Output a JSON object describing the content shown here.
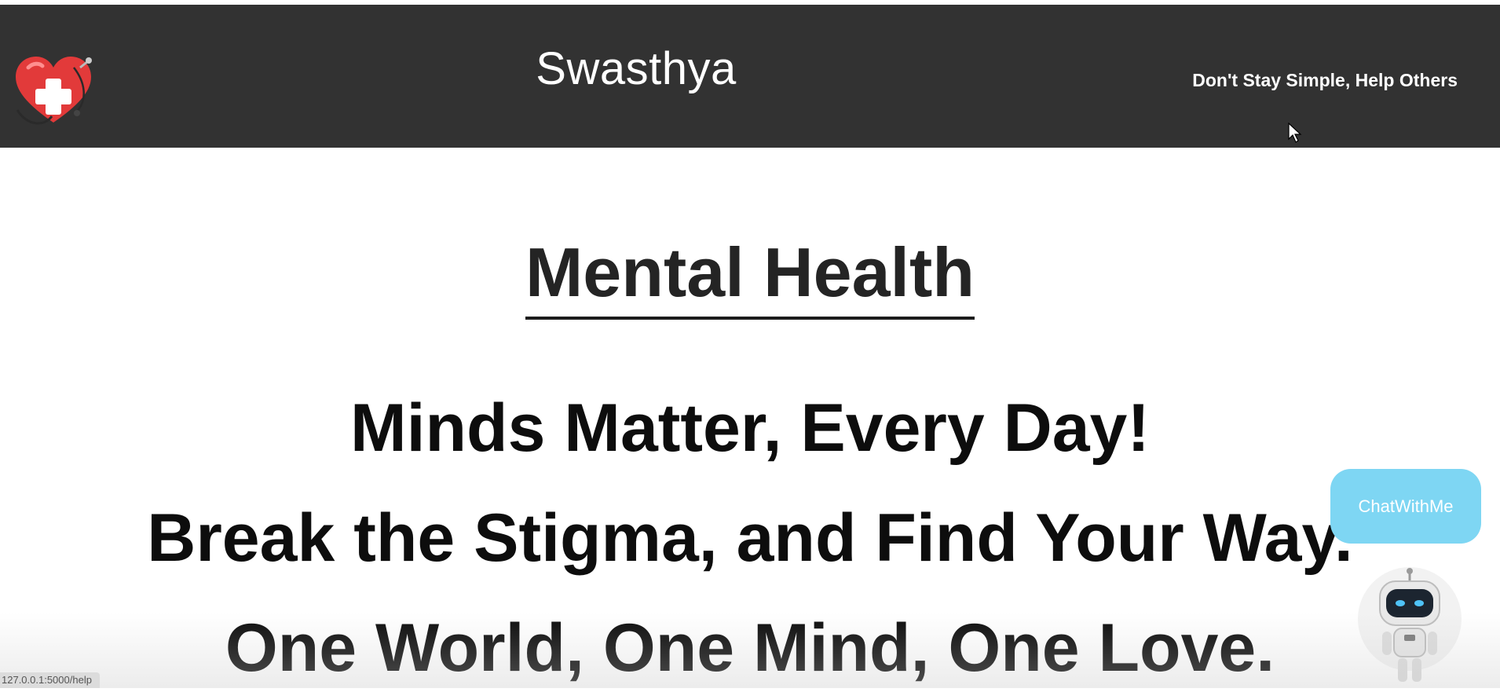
{
  "header": {
    "title": "Swasthya",
    "tagline": "Don't Stay Simple, Help Others",
    "logo_icon": "heart-medical-cross-icon",
    "background_color": "#323232"
  },
  "main": {
    "heading": "Mental Health",
    "slogans": [
      "Minds Matter, Every Day!",
      "Break the Stigma, and Find Your Way.",
      "One World, One Mind, One Love."
    ]
  },
  "chat": {
    "button_label": "ChatWithMe",
    "button_color": "#7ed6f3",
    "robot_icon": "robot-assistant-icon"
  },
  "status_bar": {
    "url": "127.0.0.1:5000/help"
  }
}
